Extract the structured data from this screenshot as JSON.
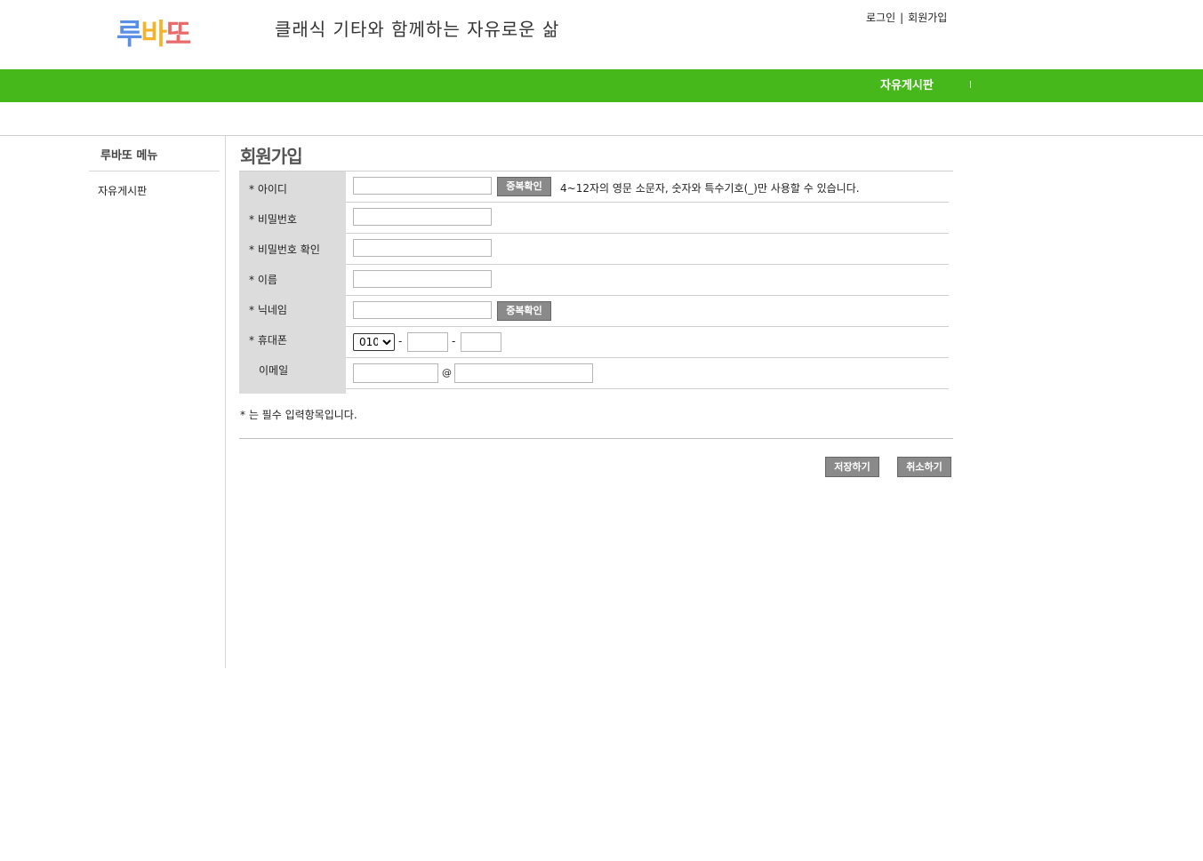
{
  "header": {
    "logo": [
      "루",
      "바",
      "또"
    ],
    "slogan": "클래식 기타와 함께하는 자유로운 삶",
    "login": "로그인",
    "separator": "|",
    "signup": "회원가입"
  },
  "nav": {
    "items": [
      "자유게시판"
    ]
  },
  "sidebar": {
    "title": "루바또 메뉴",
    "items": [
      "자유게시판"
    ]
  },
  "form": {
    "title": "회원가입",
    "fields": {
      "id": {
        "label": "* 아이디",
        "value": ""
      },
      "password": {
        "label": "* 비밀번호",
        "value": ""
      },
      "password_confirm": {
        "label": "* 비밀번호 확인",
        "value": ""
      },
      "name": {
        "label": "* 이름",
        "value": ""
      },
      "nickname": {
        "label": "* 닉네임",
        "value": ""
      },
      "phone": {
        "label": "* 휴대폰",
        "prefix": "010",
        "middle": "",
        "last": ""
      },
      "email": {
        "label": "이메일",
        "local": "",
        "at": "@",
        "domain": ""
      }
    },
    "dup_check_label": "중복확인",
    "id_hint": "4~12자의 영문 소문자, 숫자와 특수기호(_)만 사용할 수 있습니다.",
    "phone_separator": "-",
    "required_note": "* 는 필수 입력항목입니다.",
    "save_label": "저장하기",
    "cancel_label": "취소하기"
  },
  "colors": {
    "nav_green": "#46b81b",
    "label_bg": "#dcdcdc",
    "button_gray": "#8a8a8a"
  }
}
